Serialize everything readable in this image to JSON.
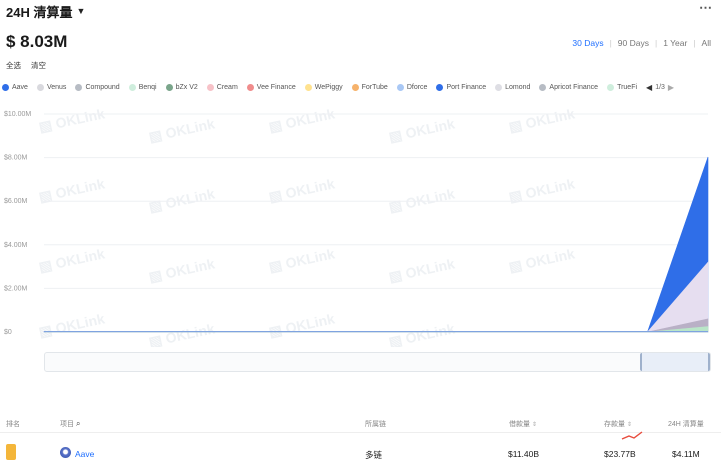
{
  "header": {
    "title": "24H 清算量",
    "more_icon": "⋯"
  },
  "summary": {
    "total_value": "$ 8.03M"
  },
  "ranges": {
    "items": [
      "30 Days",
      "90 Days",
      "1 Year",
      "All"
    ],
    "active": "30 Days"
  },
  "toggles": {
    "select_all": "全选",
    "clear": "清空"
  },
  "legend": {
    "items": [
      {
        "label": "Aave",
        "color": "#2f6ee8"
      },
      {
        "label": "Venus",
        "color": "#d9d9de"
      },
      {
        "label": "Compound",
        "color": "#b7bcc4"
      },
      {
        "label": "Benqi",
        "color": "#cfeedd"
      },
      {
        "label": "bZx V2",
        "color": "#7aa58b"
      },
      {
        "label": "Cream",
        "color": "#f7c2c8"
      },
      {
        "label": "Vee Finance",
        "color": "#f08c8c"
      },
      {
        "label": "WePiggy",
        "color": "#ffe28f"
      },
      {
        "label": "ForTube",
        "color": "#f6b26b"
      },
      {
        "label": "Dforce",
        "color": "#a9c8f5"
      },
      {
        "label": "Port Finance",
        "color": "#2f6ee8"
      },
      {
        "label": "Lomond",
        "color": "#dedee4"
      },
      {
        "label": "Apricot Finance",
        "color": "#b7bcc4"
      },
      {
        "label": "TrueFi",
        "color": "#cfeedd"
      }
    ],
    "page": "1/3"
  },
  "chart_data": {
    "type": "area",
    "y_tick_labels": [
      "$10.00M",
      "$8.00M",
      "$6.00M",
      "$4.00M",
      "$2.00M",
      "$0"
    ],
    "ylim": [
      0,
      10000000
    ],
    "watermark": "OKLink",
    "series": [
      {
        "name": "Aave",
        "color": "#2f6ee8",
        "values": [
          0.02,
          0.02,
          0.02,
          0.02,
          0.02,
          0.02,
          0.02,
          0.02,
          0.02,
          0.02,
          0.02,
          8.03
        ]
      },
      {
        "name": "Venus",
        "color": "#e6def0",
        "values": [
          0.01,
          0.01,
          0.01,
          0.01,
          0.01,
          0.01,
          0.01,
          0.01,
          0.01,
          0.01,
          0.01,
          3.2
        ]
      },
      {
        "name": "Compound",
        "color": "#b9b0c6",
        "values": [
          0,
          0,
          0,
          0,
          0,
          0,
          0,
          0,
          0,
          0,
          0,
          0.6
        ]
      },
      {
        "name": "Benqi",
        "color": "#b9e6c8",
        "values": [
          0,
          0,
          0,
          0,
          0,
          0,
          0,
          0,
          0,
          0,
          0,
          0.25
        ]
      }
    ]
  },
  "table": {
    "columns": {
      "rank": "排名",
      "asset": "项目",
      "chain": "所属链",
      "borrow": "借款量",
      "deposit": "存款量",
      "liquidation": "24H 清算量"
    },
    "rows": [
      {
        "asset": "Aave",
        "chain": "多链",
        "borrow": "$11.40B",
        "deposit": "$23.77B",
        "liquidation": "$4.11M"
      }
    ]
  }
}
